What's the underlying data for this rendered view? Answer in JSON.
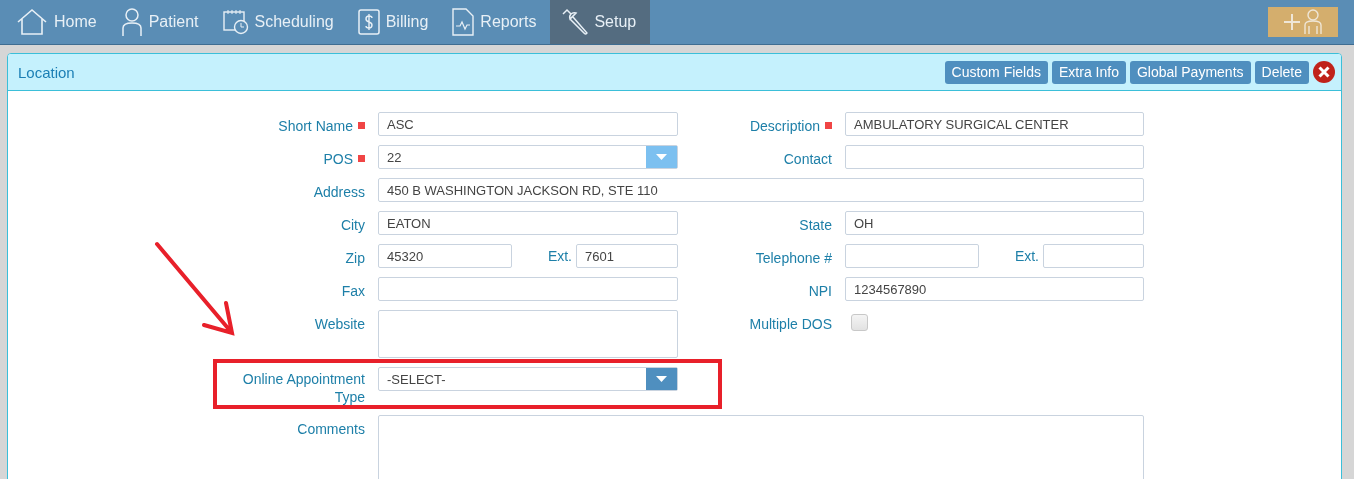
{
  "nav": {
    "items": [
      {
        "label": "Home",
        "kind": "home",
        "selected": false
      },
      {
        "label": "Patient",
        "kind": "person",
        "selected": false
      },
      {
        "label": "Scheduling",
        "kind": "calendar",
        "selected": false
      },
      {
        "label": "Billing",
        "kind": "dollar",
        "selected": false
      },
      {
        "label": "Reports",
        "kind": "report",
        "selected": false
      },
      {
        "label": "Setup",
        "kind": "wrench",
        "selected": true
      }
    ]
  },
  "panel": {
    "title": "Location",
    "buttons": [
      "Custom Fields",
      "Extra Info",
      "Global Payments",
      "Delete"
    ]
  },
  "form": {
    "rows": [
      {
        "left": {
          "kind": "text",
          "label": "Short Name",
          "required": true,
          "value": "ASC"
        },
        "right": {
          "kind": "text",
          "label": "Description",
          "required": true,
          "value": "AMBULATORY SURGICAL CENTER"
        }
      },
      {
        "left": {
          "kind": "select",
          "label": "POS",
          "required": true,
          "value": "22",
          "active": true
        },
        "right": {
          "kind": "text",
          "label": "Contact",
          "required": false
        }
      },
      {
        "left": {
          "kind": "wide",
          "label": "Address",
          "required": false,
          "value": "450 B WASHINGTON JACKSON RD, STE 110"
        }
      },
      {
        "left": {
          "kind": "text",
          "label": "City",
          "required": false,
          "value": "EATON"
        },
        "right": {
          "kind": "text",
          "label": "State",
          "required": false,
          "value": "OH"
        }
      },
      {
        "left": {
          "kind": "split",
          "label": "Zip",
          "required": false,
          "value": "45320",
          "ext_label": "Ext.",
          "ext_value": "7601"
        },
        "right": {
          "kind": "split",
          "label": "Telephone #",
          "required": false,
          "ext_label": "Ext."
        }
      },
      {
        "left": {
          "kind": "text",
          "label": "Fax",
          "required": false
        },
        "right": {
          "kind": "text",
          "label": "NPI",
          "required": false,
          "value": "1234567890"
        }
      },
      {
        "left": {
          "kind": "textarea",
          "label": "Website",
          "required": false
        },
        "right": {
          "kind": "checkbox",
          "label": "Multiple DOS",
          "required": false,
          "checked": false
        }
      },
      {
        "left": {
          "kind": "select",
          "label": "Online Appointment Type",
          "required": false,
          "value": "-SELECT-",
          "active": false
        },
        "highlighted": true
      },
      {
        "left": {
          "kind": "bigtext",
          "label": "Comments",
          "required": false
        }
      }
    ]
  }
}
